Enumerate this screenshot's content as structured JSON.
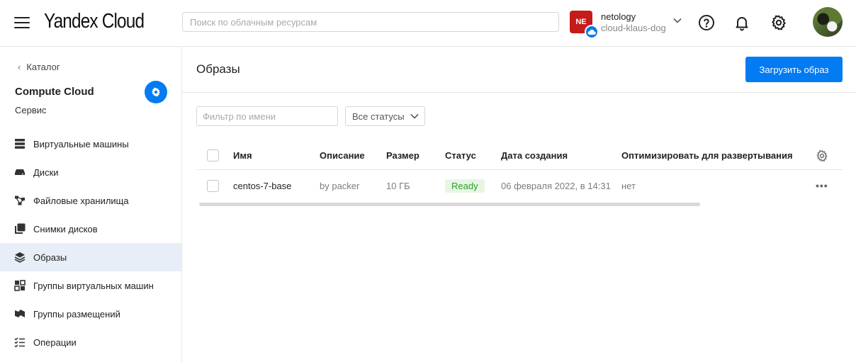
{
  "header": {
    "logo": "Yandex Cloud",
    "search_placeholder": "Поиск по облачным ресурсам",
    "account": {
      "badge": "NE",
      "name": "netology",
      "folder": "cloud-klaus-dog"
    },
    "icons": [
      "help-icon",
      "bell-icon",
      "gear-icon"
    ]
  },
  "sidebar": {
    "back_label": "Каталог",
    "service_title": "Compute Cloud",
    "service_subtitle": "Сервис",
    "items": [
      {
        "label": "Виртуальные машины",
        "icon": "servers-icon"
      },
      {
        "label": "Диски",
        "icon": "disk-icon"
      },
      {
        "label": "Файловые хранилища",
        "icon": "file-storage-icon"
      },
      {
        "label": "Снимки дисков",
        "icon": "snapshot-icon"
      },
      {
        "label": "Образы",
        "icon": "layers-icon",
        "active": true
      },
      {
        "label": "Группы виртуальных машин",
        "icon": "instance-groups-icon"
      },
      {
        "label": "Группы размещений",
        "icon": "placement-groups-icon"
      },
      {
        "label": "Операции",
        "icon": "operations-list-icon"
      }
    ]
  },
  "main": {
    "title": "Образы",
    "upload_button": "Загрузить образ",
    "filter_placeholder": "Фильтр по имени",
    "status_select": "Все статусы",
    "table": {
      "columns": [
        "Имя",
        "Описание",
        "Размер",
        "Статус",
        "Дата создания",
        "Оптимизировать для развертывания"
      ],
      "rows": [
        {
          "name": "centos-7-base",
          "description": "by packer",
          "size": "10 ГБ",
          "status": "Ready",
          "created": "06 февраля 2022, в 14:31",
          "optimize": "нет"
        }
      ]
    }
  },
  "colors": {
    "accent": "#027bf3",
    "account_badge": "#c41b1b",
    "active_nav_bg": "#e8eef8",
    "ready_bg": "#e7f6e2",
    "ready_text": "#2e9e2e"
  }
}
